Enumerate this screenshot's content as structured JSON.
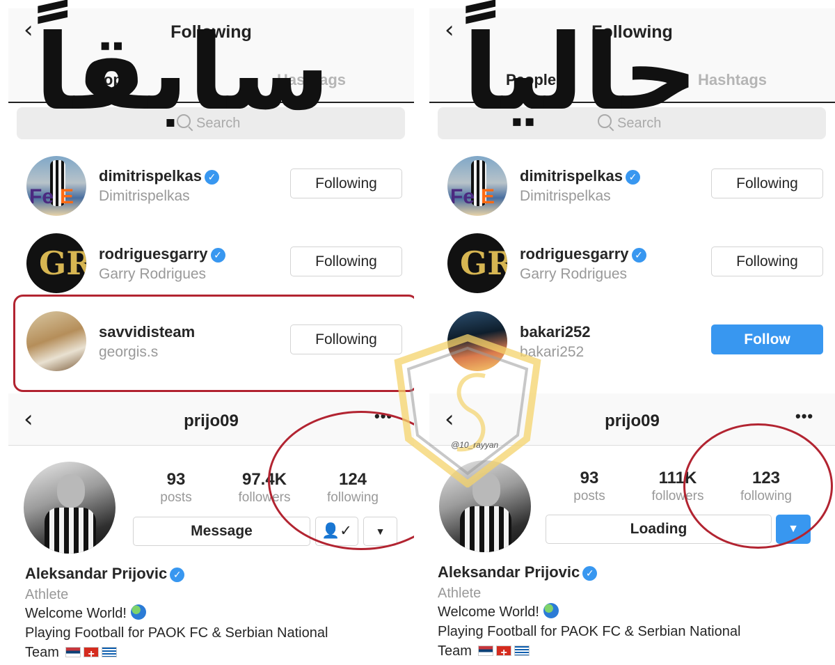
{
  "left_panel": {
    "overlay_word": "سابقاً",
    "following_screen": {
      "title": "Following",
      "tabs": [
        "People",
        "Hashtags"
      ],
      "search_placeholder": "Search",
      "rows": [
        {
          "username": "dimitrispelkas",
          "full_name": "Dimitrispelkas",
          "verified": true,
          "button": "Following"
        },
        {
          "username": "rodriguesgarry",
          "full_name": "Garry Rodrigues",
          "verified": true,
          "button": "Following"
        },
        {
          "username": "savvidisteam",
          "full_name": "georgis.s",
          "verified": false,
          "button": "Following"
        }
      ]
    },
    "profile": {
      "username": "prijo09",
      "posts": "93",
      "posts_label": "posts",
      "followers": "97.4K",
      "followers_label": "followers",
      "following": "124",
      "following_label": "following",
      "primary_button": "Message",
      "name": "Aleksandar Prijovic",
      "category": "Athlete",
      "bio_line1": "Welcome World!",
      "bio_line2": "Playing Football for PAOK FC & Serbian National",
      "bio_line3": "Team"
    }
  },
  "right_panel": {
    "overlay_word": "حالياً",
    "following_screen": {
      "title": "Following",
      "tabs": [
        "People",
        "Hashtags"
      ],
      "search_placeholder": "Search",
      "rows": [
        {
          "username": "dimitrispelkas",
          "full_name": "Dimitrispelkas",
          "verified": true,
          "button": "Following"
        },
        {
          "username": "rodriguesgarry",
          "full_name": "Garry Rodrigues",
          "verified": true,
          "button": "Following"
        },
        {
          "username": "bakari252",
          "full_name": "bakari252",
          "verified": false,
          "button": "Follow"
        }
      ]
    },
    "profile": {
      "username": "prijo09",
      "posts": "93",
      "posts_label": "posts",
      "followers": "111K",
      "followers_label": "followers",
      "following": "123",
      "following_label": "following",
      "primary_button": "Loading",
      "name": "Aleksandar Prijovic",
      "category": "Athlete",
      "bio_line1": "Welcome World!",
      "bio_line2": "Playing Football for PAOK FC & Serbian National",
      "bio_line3": "Team"
    }
  },
  "watermark": "@10_rayyan",
  "colors": {
    "accent": "#3897f0",
    "annotation_red": "#b22431",
    "watermark_gold": "#f4d36b"
  }
}
